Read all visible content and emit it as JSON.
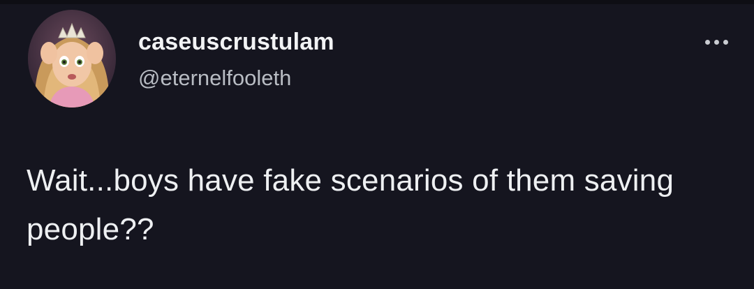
{
  "tweet": {
    "author": {
      "display_name": "caseuscrustulam",
      "handle": "@eternelfooleth",
      "avatar_icon": "avatar-princess-image"
    },
    "more_icon": "more-options-icon",
    "text": "Wait...boys have fake scenarios of them saving people??"
  },
  "colors": {
    "background": "#15151f",
    "name": "#f2f3f5",
    "handle": "#b8bcc3",
    "text": "#eef0f2"
  }
}
